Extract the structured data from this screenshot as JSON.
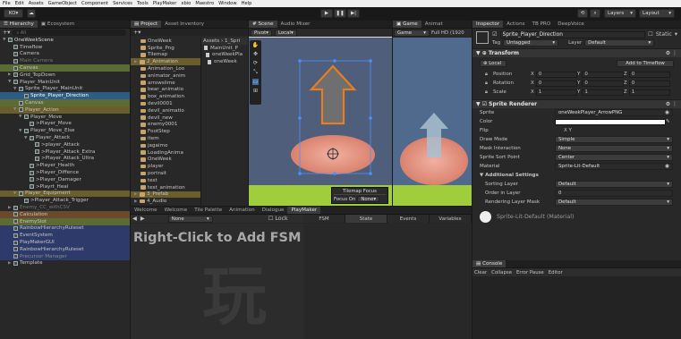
{
  "menu": [
    "File",
    "Edit",
    "Assets",
    "GameObject",
    "Component",
    "Services",
    "Tools",
    "PlayMaker",
    "xbio",
    "Maestro",
    "Window",
    "Help"
  ],
  "toolbar": {
    "account": "KO",
    "layers": "Layers",
    "layout": "Layout"
  },
  "hierarchy": {
    "tab": "Hierarchy",
    "tab2": "Ecosystem",
    "search_placeholder": "All",
    "rows": [
      {
        "text": "OneWeekScene",
        "depth": 0,
        "arrow": "▼",
        "color": "#dcdcdc",
        "bg": "",
        "icon": "cube"
      },
      {
        "text": "Timeflow",
        "depth": 1,
        "arrow": "",
        "color": "#c4c4c4",
        "bg": "",
        "icon": "cube"
      },
      {
        "text": "Camera",
        "depth": 1,
        "arrow": "",
        "color": "#c4c4c4",
        "bg": "",
        "icon": "cube"
      },
      {
        "text": "Main Camera",
        "depth": 1,
        "arrow": "",
        "color": "#777777",
        "bg": "",
        "icon": "cube"
      },
      {
        "text": "Canvas",
        "depth": 1,
        "arrow": "",
        "color": "#c4c4c4",
        "bg": "#5c6a34",
        "icon": "cube"
      },
      {
        "text": "Grid_TopDown",
        "depth": 1,
        "arrow": "▶",
        "color": "#c4c4c4",
        "bg": "",
        "icon": "cube"
      },
      {
        "text": "Player_MainUnit",
        "depth": 1,
        "arrow": "▼",
        "color": "#c4c4c4",
        "bg": "",
        "icon": "cube"
      },
      {
        "text": "Sprite_Player_MainUnit",
        "depth": 2,
        "arrow": "▼",
        "color": "#c4c4c4",
        "bg": "",
        "icon": "cube"
      },
      {
        "text": "Sprite_Player_Direction",
        "depth": 3,
        "arrow": "",
        "color": "#ffffff",
        "bg": "#2c5d87",
        "icon": "cube"
      },
      {
        "text": "Canvas",
        "depth": 2,
        "arrow": "",
        "color": "#c4c4c4",
        "bg": "#5c6a34",
        "icon": "cube"
      },
      {
        "text": "Player_Action",
        "depth": 2,
        "arrow": "▼",
        "color": "#c4c4c4",
        "bg": "#6a5e2c",
        "icon": "cube"
      },
      {
        "text": "Player_Move",
        "depth": 3,
        "arrow": "▼",
        "color": "#c4c4c4",
        "bg": "",
        "icon": "cube"
      },
      {
        "text": ">Player_Move",
        "depth": 4,
        "arrow": "",
        "color": "#c4c4c4",
        "bg": "",
        "icon": "cube"
      },
      {
        "text": "Player_Move_Else",
        "depth": 3,
        "arrow": "▼",
        "color": "#c4c4c4",
        "bg": "",
        "icon": "cube"
      },
      {
        "text": "Player_Attack",
        "depth": 4,
        "arrow": "▼",
        "color": "#c4c4c4",
        "bg": "",
        "icon": "cube"
      },
      {
        "text": ">player_Attack",
        "depth": 5,
        "arrow": "",
        "color": "#c4c4c4",
        "bg": "",
        "icon": "cube"
      },
      {
        "text": ">Player_Attack_Extra",
        "depth": 5,
        "arrow": "",
        "color": "#c4c4c4",
        "bg": "",
        "icon": "cube"
      },
      {
        "text": ">Player_Attack_Ultra",
        "depth": 5,
        "arrow": "",
        "color": "#c4c4c4",
        "bg": "",
        "icon": "cube"
      },
      {
        "text": ">Player_Health",
        "depth": 4,
        "arrow": "",
        "color": "#c4c4c4",
        "bg": "",
        "icon": "cube"
      },
      {
        "text": ">Player_Diffence",
        "depth": 4,
        "arrow": "",
        "color": "#c4c4c4",
        "bg": "",
        "icon": "cube"
      },
      {
        "text": ">Player_Damager",
        "depth": 4,
        "arrow": "",
        "color": "#c4c4c4",
        "bg": "",
        "icon": "cube"
      },
      {
        "text": ">Playrt_Heal",
        "depth": 4,
        "arrow": "",
        "color": "#c4c4c4",
        "bg": "",
        "icon": "cube"
      },
      {
        "text": "Player_Equipment",
        "depth": 2,
        "arrow": "▼",
        "color": "#c4c4c4",
        "bg": "#6a5e2c",
        "icon": "cube"
      },
      {
        "text": ">Player_Attack_Trigger",
        "depth": 3,
        "arrow": "",
        "color": "#c4c4c4",
        "bg": "",
        "icon": "cube"
      },
      {
        "text": "Enemy_CC_withCSV",
        "depth": 1,
        "arrow": "▶",
        "color": "#777777",
        "bg": "",
        "icon": "cube"
      },
      {
        "text": "Calculation",
        "depth": 1,
        "arrow": "",
        "color": "#c4c4c4",
        "bg": "#6a4a2a",
        "icon": "cube"
      },
      {
        "text": "EnemySlot",
        "depth": 1,
        "arrow": "",
        "color": "#c4c4c4",
        "bg": "#5c6a34",
        "icon": "cube"
      },
      {
        "text": "RainbowHierarchyRuleset",
        "depth": 1,
        "arrow": "",
        "color": "#c4c4c4",
        "bg": "#2e3a6a",
        "icon": "cube"
      },
      {
        "text": "EventSystem",
        "depth": 1,
        "arrow": "",
        "color": "#c4c4c4",
        "bg": "#2e3a6a",
        "icon": "cube"
      },
      {
        "text": "PlayMakerGUI",
        "depth": 1,
        "arrow": "",
        "color": "#c4c4c4",
        "bg": "#2e3a6a",
        "icon": "cube"
      },
      {
        "text": "RainbowHierarchyRuleset",
        "depth": 1,
        "arrow": "",
        "color": "#c4c4c4",
        "bg": "#2e3a6a",
        "icon": "cube"
      },
      {
        "text": "Precursor Manager",
        "depth": 1,
        "arrow": "",
        "color": "#8a8a8a",
        "bg": "#2e3a6a",
        "icon": "cube"
      },
      {
        "text": "Template",
        "depth": 1,
        "arrow": "▶",
        "color": "#c4c4c4",
        "bg": "",
        "icon": "cube"
      }
    ]
  },
  "project": {
    "tab": "Project",
    "tab2": "Asset Inventory",
    "left": [
      {
        "text": "OneWeek",
        "depth": 1,
        "hl": ""
      },
      {
        "text": "Sprite_Png",
        "depth": 1,
        "hl": ""
      },
      {
        "text": "Tilemap",
        "depth": 1,
        "hl": ""
      },
      {
        "text": "2_Animation",
        "depth": 0,
        "hl": "#6a5e2c"
      },
      {
        "text": "Animation_Loo",
        "depth": 1,
        "hl": ""
      },
      {
        "text": "animator_anim",
        "depth": 1,
        "hl": ""
      },
      {
        "text": "arrowslime",
        "depth": 1,
        "hl": ""
      },
      {
        "text": "bear_animatio",
        "depth": 1,
        "hl": ""
      },
      {
        "text": "box_animation",
        "depth": 1,
        "hl": ""
      },
      {
        "text": "devil0001",
        "depth": 1,
        "hl": ""
      },
      {
        "text": "devil_animatio",
        "depth": 1,
        "hl": ""
      },
      {
        "text": "devil_new",
        "depth": 1,
        "hl": ""
      },
      {
        "text": "enemy0001",
        "depth": 1,
        "hl": ""
      },
      {
        "text": "FootStep",
        "depth": 1,
        "hl": ""
      },
      {
        "text": "item",
        "depth": 1,
        "hl": ""
      },
      {
        "text": "jagaimo",
        "depth": 1,
        "hl": ""
      },
      {
        "text": "LoadingAnima",
        "depth": 1,
        "hl": ""
      },
      {
        "text": "OneWeek",
        "depth": 1,
        "hl": ""
      },
      {
        "text": "player",
        "depth": 1,
        "hl": ""
      },
      {
        "text": "portrait",
        "depth": 1,
        "hl": ""
      },
      {
        "text": "test",
        "depth": 1,
        "hl": ""
      },
      {
        "text": "test_animation",
        "depth": 1,
        "hl": ""
      },
      {
        "text": "3_Prefab",
        "depth": 0,
        "hl": "#6a5e2c"
      },
      {
        "text": "4_Audio",
        "depth": 0,
        "hl": ""
      }
    ],
    "breadcrumb": "Assets › 1_Spri",
    "right": [
      "MainUnit_P",
      "oneWeekPla",
      "oneWeek"
    ]
  },
  "scene": {
    "tabs": [
      "Scene",
      "Audio Mixer"
    ],
    "pivot": "Pivot",
    "local": "Local",
    "tilemap_focus": "Tilemap Focus",
    "focus_on": "Focus On",
    "focus_value": "None"
  },
  "game": {
    "tabs": [
      "Game",
      "Animat"
    ],
    "display": "Game",
    "resolution": "Full HD (1920"
  },
  "bottom_tabs": [
    "Welcome",
    "Welcome",
    "Tile Palette",
    "Animation",
    "Dialogue",
    "PlayMaker"
  ],
  "playmaker": {
    "none": "None",
    "lock": "Lock",
    "tabs": [
      "FSM",
      "State",
      "Events",
      "Variables"
    ],
    "hint": "Right-Click to Add FSM",
    "watermark": "玩"
  },
  "inspector": {
    "tabs": [
      "Inspector",
      "Actions",
      "TB PRO",
      "DeepVoice"
    ],
    "name": "Sprite_Player_Direction",
    "static": "Static",
    "tag_label": "Tag",
    "tag_value": "Untagged",
    "layer_label": "Layer",
    "layer_value": "Default",
    "transform": "Transform",
    "local": "Local",
    "add_timeflow": "Add to Timeflow",
    "position": {
      "label": "Position",
      "x": "0",
      "y": "0",
      "z": "0"
    },
    "rotation": {
      "label": "Rotation",
      "x": "0",
      "y": "0",
      "z": "0"
    },
    "scale": {
      "label": "Scale",
      "x": "1",
      "y": "1",
      "z": "1"
    },
    "sprite_renderer": "Sprite Renderer",
    "fields": [
      {
        "label": "Sprite",
        "value": "oneWeekPlayer_ArrowPNG",
        "kind": "obj"
      },
      {
        "label": "Color",
        "value": "",
        "kind": "color"
      },
      {
        "label": "Flip",
        "value": "X   Y",
        "kind": "flip"
      },
      {
        "label": "Draw Mode",
        "value": "Simple",
        "kind": "dd"
      },
      {
        "label": "Mask Interaction",
        "value": "None",
        "kind": "dd"
      },
      {
        "label": "Sprite Sort Point",
        "value": "Center",
        "kind": "dd"
      },
      {
        "label": "Material",
        "value": "Sprite-Lit-Default",
        "kind": "obj"
      }
    ],
    "additional": "Additional Settings",
    "sorting_layer": {
      "label": "Sorting Layer",
      "value": "Default"
    },
    "order_in_layer": {
      "label": "Order in Layer",
      "value": "0"
    },
    "rendering_mask": {
      "label": "Rendering Layer Mask",
      "value": "Default"
    },
    "material_name": "Sprite-Lit-Default (Material)"
  },
  "console": {
    "tab": "Console",
    "buttons": [
      "Clear",
      "Collapse",
      "Error Pause",
      "Editor"
    ]
  }
}
